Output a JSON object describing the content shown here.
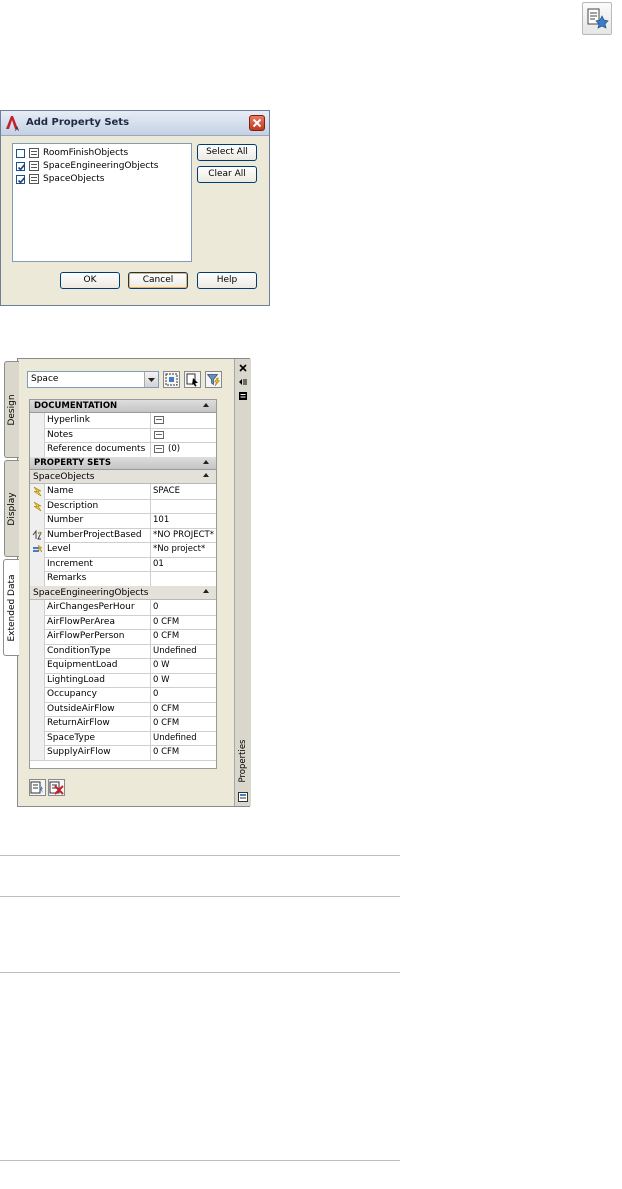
{
  "dialog": {
    "title": "Add Property Sets",
    "items": [
      {
        "label": "RoomFinishObjects",
        "checked": false
      },
      {
        "label": "SpaceEngineeringObjects",
        "checked": true
      },
      {
        "label": "SpaceObjects",
        "checked": true
      }
    ],
    "select_all_label": "Select All",
    "clear_all_label": "Clear All",
    "ok_label": "OK",
    "cancel_label": "Cancel",
    "help_label": "Help"
  },
  "palette": {
    "style_select_value": "Space",
    "tabs": {
      "design": "Design",
      "display": "Display",
      "extended_data": "Extended Data"
    },
    "side_title": "Properties",
    "documentation": {
      "header": "DOCUMENTATION",
      "rows": [
        {
          "name": "Hyperlink",
          "value": ""
        },
        {
          "name": "Notes",
          "value": ""
        },
        {
          "name": "Reference documents",
          "value": "(0)"
        }
      ]
    },
    "property_sets": {
      "header": "PROPERTY SETS",
      "space_objects": {
        "label": "SpaceObjects",
        "rows": [
          {
            "name": "Name",
            "value": "SPACE",
            "icon": "lightning-icon"
          },
          {
            "name": "Description",
            "value": "",
            "icon": "lightning-icon"
          },
          {
            "name": "Number",
            "value": "101",
            "icon": ""
          },
          {
            "name": "NumberProjectBased",
            "value": "*NO PROJECT*",
            "icon": "auto-number-icon"
          },
          {
            "name": "Level",
            "value": "*No project*",
            "icon": "level-icon"
          },
          {
            "name": "Increment",
            "value": "01",
            "icon": ""
          },
          {
            "name": "Remarks",
            "value": "",
            "icon": ""
          }
        ]
      },
      "space_engineering_objects": {
        "label": "SpaceEngineeringObjects",
        "rows": [
          {
            "name": "AirChangesPerHour",
            "value": "0"
          },
          {
            "name": "AirFlowPerArea",
            "value": "0 CFM"
          },
          {
            "name": "AirFlowPerPerson",
            "value": "0 CFM"
          },
          {
            "name": "ConditionType",
            "value": "Undefined"
          },
          {
            "name": "EquipmentLoad",
            "value": "0 W"
          },
          {
            "name": "LightingLoad",
            "value": "0 W"
          },
          {
            "name": "Occupancy",
            "value": "0"
          },
          {
            "name": "OutsideAirFlow",
            "value": "0 CFM"
          },
          {
            "name": "ReturnAirFlow",
            "value": "0 CFM"
          },
          {
            "name": "SpaceType",
            "value": "Undefined"
          },
          {
            "name": "SupplyAirFlow",
            "value": "0 CFM"
          }
        ]
      }
    }
  },
  "colors": {
    "accent": "#f8b253",
    "dialog_bg": "#ece9d8",
    "close_red": "#c03a1c"
  }
}
